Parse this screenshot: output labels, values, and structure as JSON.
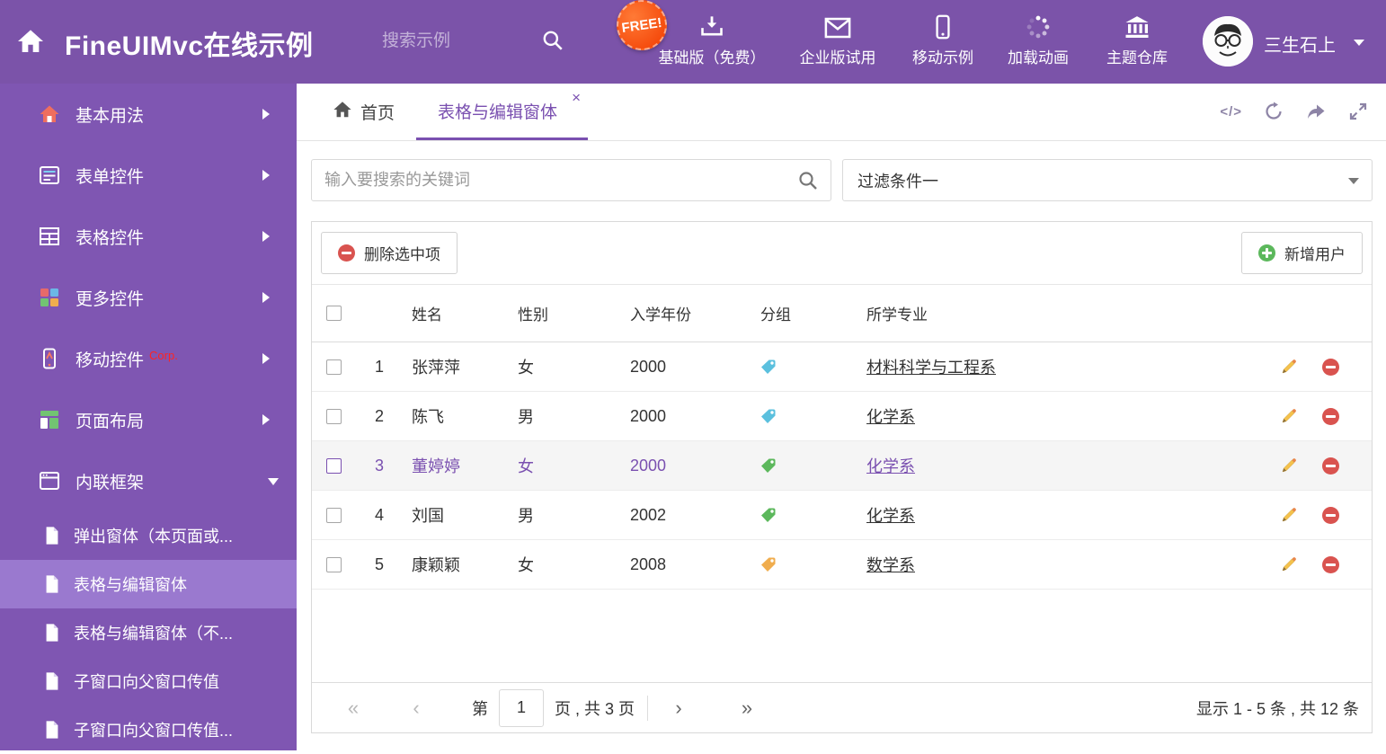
{
  "header": {
    "title": "FineUIMvc在线示例",
    "search_placeholder": "搜索示例",
    "free_badge": "FREE!",
    "nav_items": [
      {
        "label": "基础版（免费）",
        "icon": "download-icon"
      },
      {
        "label": "企业版试用",
        "icon": "envelope-icon"
      },
      {
        "label": "移动示例",
        "icon": "mobile-icon"
      },
      {
        "label": "加载动画",
        "icon": "spinner-icon"
      },
      {
        "label": "主题仓库",
        "icon": "bank-icon"
      }
    ],
    "user_name": "三生石上"
  },
  "sidebar": {
    "items": [
      {
        "label": "基本用法"
      },
      {
        "label": "表单控件"
      },
      {
        "label": "表格控件"
      },
      {
        "label": "更多控件"
      },
      {
        "label": "移动控件",
        "badge": "Corp."
      },
      {
        "label": "页面布局"
      },
      {
        "label": "内联框架"
      }
    ],
    "subitems": [
      {
        "label": "弹出窗体（本页面或..."
      },
      {
        "label": "表格与编辑窗体"
      },
      {
        "label": "表格与编辑窗体（不..."
      },
      {
        "label": "子窗口向父窗口传值"
      },
      {
        "label": "子窗口向父窗口传值..."
      }
    ]
  },
  "tabs": {
    "home": "首页",
    "active": "表格与编辑窗体",
    "close_icon": "×",
    "code_icon": "</>"
  },
  "filters": {
    "search_placeholder": "输入要搜索的关键词",
    "dropdown_value": "过滤条件一"
  },
  "toolbar": {
    "delete_label": "删除选中项",
    "add_label": "新增用户"
  },
  "table": {
    "columns": {
      "name": "姓名",
      "gender": "性别",
      "year": "入学年份",
      "group": "分组",
      "major": "所学专业"
    },
    "rows": [
      {
        "index": "1",
        "name": "张萍萍",
        "gender": "女",
        "year": "2000",
        "tag_color": "#5bc0de",
        "major": "材料科学与工程系"
      },
      {
        "index": "2",
        "name": "陈飞",
        "gender": "男",
        "year": "2000",
        "tag_color": "#5bc0de",
        "major": "化学系"
      },
      {
        "index": "3",
        "name": "董婷婷",
        "gender": "女",
        "year": "2000",
        "tag_color": "#5cb85c",
        "major": "化学系"
      },
      {
        "index": "4",
        "name": "刘国",
        "gender": "男",
        "year": "2002",
        "tag_color": "#5cb85c",
        "major": "化学系"
      },
      {
        "index": "5",
        "name": "康颖颖",
        "gender": "女",
        "year": "2008",
        "tag_color": "#f0ad4e",
        "major": "数学系"
      }
    ]
  },
  "pagination": {
    "first": "«",
    "prev": "‹",
    "next": "›",
    "last": "»",
    "label_before": "第",
    "page": "1",
    "label_after": "页 , 共 3 页",
    "summary": "显示 1 - 5 条 , 共 12 条"
  },
  "colors": {
    "header_purple": "#7b53a9",
    "sidebar_purple": "#7f56b2",
    "accent_purple": "#7a50b0",
    "tag_blue": "#5bc0de",
    "tag_green": "#5cb85c",
    "tag_orange": "#f0ad4e",
    "delete_red": "#d9534f",
    "add_green": "#5cb85c"
  }
}
